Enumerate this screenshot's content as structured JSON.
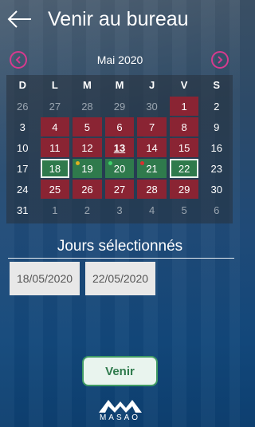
{
  "header": {
    "title": "Venir au bureau"
  },
  "calendar": {
    "month_label": "Mai 2020",
    "weekdays": [
      "D",
      "L",
      "M",
      "M",
      "J",
      "V",
      "S"
    ],
    "days": [
      {
        "n": "26",
        "cls": "other"
      },
      {
        "n": "27",
        "cls": "other"
      },
      {
        "n": "28",
        "cls": "other"
      },
      {
        "n": "29",
        "cls": "other"
      },
      {
        "n": "30",
        "cls": "other"
      },
      {
        "n": "1",
        "cls": "red"
      },
      {
        "n": "2",
        "cls": "weekend"
      },
      {
        "n": "3",
        "cls": "weekend"
      },
      {
        "n": "4",
        "cls": "red"
      },
      {
        "n": "5",
        "cls": "red"
      },
      {
        "n": "6",
        "cls": "red"
      },
      {
        "n": "7",
        "cls": "red"
      },
      {
        "n": "8",
        "cls": "red"
      },
      {
        "n": "9",
        "cls": "weekend"
      },
      {
        "n": "10",
        "cls": "weekend"
      },
      {
        "n": "11",
        "cls": "red"
      },
      {
        "n": "12",
        "cls": "red"
      },
      {
        "n": "13",
        "cls": "red today"
      },
      {
        "n": "14",
        "cls": "red"
      },
      {
        "n": "15",
        "cls": "red"
      },
      {
        "n": "16",
        "cls": "weekend"
      },
      {
        "n": "17",
        "cls": "weekend"
      },
      {
        "n": "18",
        "cls": "green selected"
      },
      {
        "n": "19",
        "cls": "green",
        "dot": "#e0b020"
      },
      {
        "n": "20",
        "cls": "green",
        "dot": "#3fd06a"
      },
      {
        "n": "21",
        "cls": "green",
        "dot": "#d83030"
      },
      {
        "n": "22",
        "cls": "green selected"
      },
      {
        "n": "23",
        "cls": "weekend"
      },
      {
        "n": "24",
        "cls": "weekend"
      },
      {
        "n": "25",
        "cls": "red"
      },
      {
        "n": "26",
        "cls": "red"
      },
      {
        "n": "27",
        "cls": "red"
      },
      {
        "n": "28",
        "cls": "red"
      },
      {
        "n": "29",
        "cls": "red"
      },
      {
        "n": "30",
        "cls": "weekend"
      },
      {
        "n": "31",
        "cls": "weekend"
      },
      {
        "n": "1",
        "cls": "other"
      },
      {
        "n": "2",
        "cls": "other"
      },
      {
        "n": "3",
        "cls": "other"
      },
      {
        "n": "4",
        "cls": "other"
      },
      {
        "n": "5",
        "cls": "other"
      },
      {
        "n": "6",
        "cls": "other"
      }
    ]
  },
  "selection": {
    "title": "Jours sélectionnés",
    "start_date": "18/05/2020",
    "end_date": "22/05/2020"
  },
  "actions": {
    "venir_label": "Venir"
  },
  "brand": {
    "name": "MASAO"
  },
  "colors": {
    "accent_nav": "#d63a8e",
    "unavailable_day": "#8a2433",
    "available_day": "#2f7a4c",
    "button_border": "#3f9a63"
  }
}
